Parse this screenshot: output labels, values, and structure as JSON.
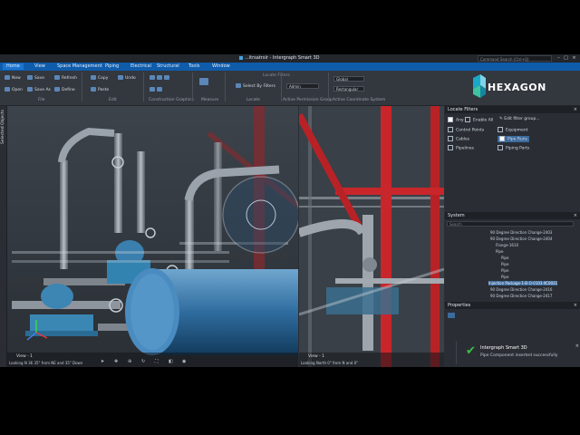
{
  "window": {
    "title": "...itrsatrslr - Intergraph Smart 3D",
    "search_placeholder": "Command Search (Ctrl+Q)"
  },
  "tabs": [
    "Home",
    "View",
    "Space Management",
    "Piping",
    "Electrical",
    "Structural",
    "Tools",
    "Window"
  ],
  "ribbon": {
    "buttons": {
      "new": "New",
      "save": "Save",
      "refresh": "Refresh",
      "open": "Open",
      "save_as": "Save As",
      "define": "Define",
      "copy": "Copy",
      "undo": "Undo",
      "paste": "Paste",
      "select_by_filters": "Select By Filters",
      "locate_filters": "Locate Filters",
      "admin": "Admin",
      "global": "Global",
      "rectangular": "Rectangular"
    },
    "groups": {
      "file": "File",
      "edit": "Edit",
      "construction_graphics": "Construction Graphics",
      "measure": "Measure",
      "locate": "Locate",
      "active_permission_group": "Active Permission Group",
      "active_coordinate_system": "Active Coordinate System"
    }
  },
  "brand": {
    "logo_text": "HEXAGON",
    "accent": "#1aa8c8"
  },
  "left_strip": {
    "label": "Selected Objects"
  },
  "viewport_left": {
    "label": "View - 1",
    "info": "Looking N 36 35\" from NE and 35\" Down"
  },
  "viewport_right": {
    "label": "View - 1",
    "info": "Looking North 0\" from N and 0\""
  },
  "locate_filters": {
    "title": "Locate Filters",
    "toolbar": {
      "any": "Any",
      "enable_all": "Enable All",
      "edit_filter_group": "Edit filter group..."
    },
    "items": [
      {
        "label": "Control Points",
        "checked": false
      },
      {
        "label": "Equipment",
        "checked": false
      },
      {
        "label": "Cables",
        "checked": false
      },
      {
        "label": "Pipe Runs",
        "checked": true
      },
      {
        "label": "Pipelines",
        "checked": false
      },
      {
        "label": "Piping Parts",
        "checked": false
      }
    ]
  },
  "system": {
    "title": "System",
    "search_placeholder": "Search",
    "tree": [
      "90 Degree Direction Change-2403",
      "90 Degree Direction Change-2404",
      "Flange-1610",
      "Pipe",
      "Pipe",
      "Pipe",
      "Pipe",
      "Pipe",
      "Injection Package-1-B-O-0103-XC0031",
      "90 Degree Direction Change-2416",
      "90 Degree Direction Change-2417"
    ],
    "selected_index": 8
  },
  "properties": {
    "title": "Properties"
  },
  "toast": {
    "title": "Intergraph Smart 3D",
    "message": "Pipe Component inserted successfully"
  },
  "colors": {
    "ribbon_blue": "#0f5cab",
    "pipe_red": "#c8262b",
    "vessel_blue": "#3a7fb5",
    "equipment_teal": "#4aa8c9"
  }
}
